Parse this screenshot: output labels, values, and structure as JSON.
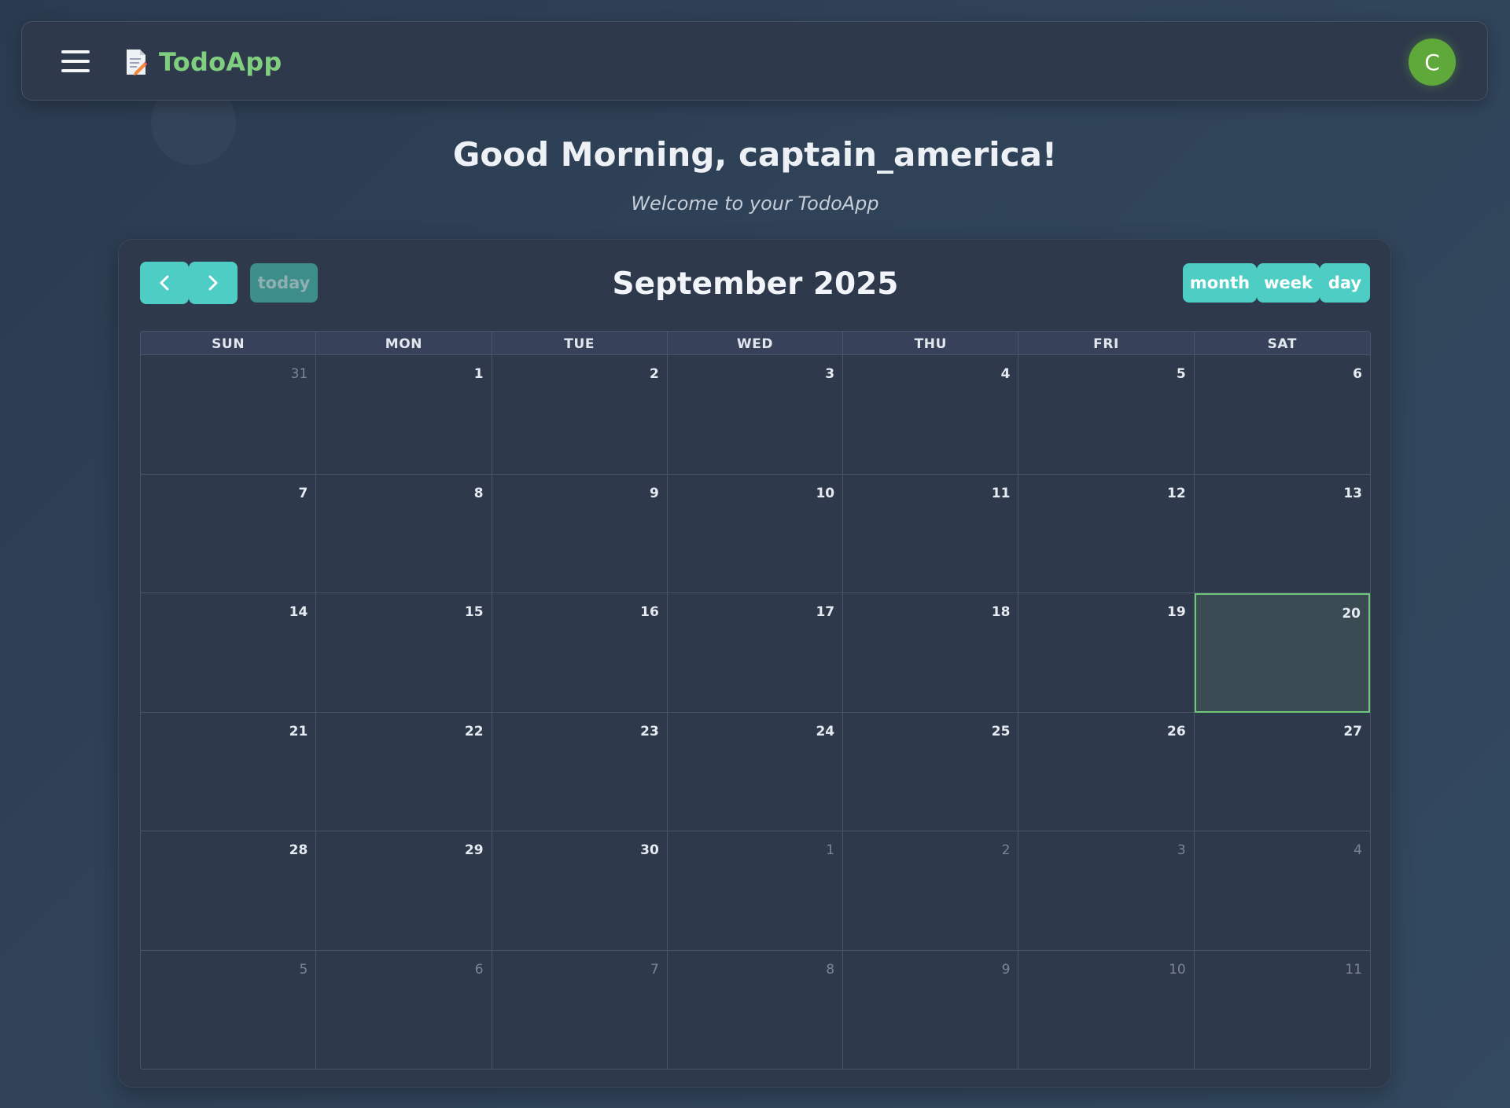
{
  "navbar": {
    "menu_icon": "hamburger-menu-icon",
    "brand_icon": "notepad-icon",
    "brand_name": "TodoApp",
    "avatar_initial": "C"
  },
  "greeting": {
    "title": "Good Morning, captain_america!",
    "subtitle": "Welcome to your TodoApp"
  },
  "calendar": {
    "title": "September 2025",
    "prev_icon": "chevron-left-icon",
    "next_icon": "chevron-right-icon",
    "today_label": "today",
    "view_buttons": {
      "month": "month",
      "week": "week",
      "day": "day"
    },
    "weekdays": [
      "SUN",
      "MON",
      "TUE",
      "WED",
      "THU",
      "FRI",
      "SAT"
    ],
    "weeks": [
      [
        {
          "d": "31",
          "other": true
        },
        {
          "d": "1"
        },
        {
          "d": "2"
        },
        {
          "d": "3"
        },
        {
          "d": "4"
        },
        {
          "d": "5"
        },
        {
          "d": "6"
        }
      ],
      [
        {
          "d": "7"
        },
        {
          "d": "8"
        },
        {
          "d": "9"
        },
        {
          "d": "10"
        },
        {
          "d": "11"
        },
        {
          "d": "12"
        },
        {
          "d": "13"
        }
      ],
      [
        {
          "d": "14"
        },
        {
          "d": "15"
        },
        {
          "d": "16"
        },
        {
          "d": "17"
        },
        {
          "d": "18"
        },
        {
          "d": "19"
        },
        {
          "d": "20",
          "today": true
        }
      ],
      [
        {
          "d": "21"
        },
        {
          "d": "22"
        },
        {
          "d": "23"
        },
        {
          "d": "24"
        },
        {
          "d": "25"
        },
        {
          "d": "26"
        },
        {
          "d": "27"
        }
      ],
      [
        {
          "d": "28"
        },
        {
          "d": "29"
        },
        {
          "d": "30"
        },
        {
          "d": "1",
          "other": true
        },
        {
          "d": "2",
          "other": true
        },
        {
          "d": "3",
          "other": true
        },
        {
          "d": "4",
          "other": true
        }
      ],
      [
        {
          "d": "5",
          "other": true
        },
        {
          "d": "6",
          "other": true
        },
        {
          "d": "7",
          "other": true
        },
        {
          "d": "8",
          "other": true
        },
        {
          "d": "9",
          "other": true
        },
        {
          "d": "10",
          "other": true
        },
        {
          "d": "11",
          "other": true
        }
      ]
    ]
  },
  "colors": {
    "accent": "#4ecdc4",
    "brand": "#7fcf7f",
    "avatar": "#5fa83a",
    "today_border": "#6fc77a",
    "card_bg": "#2e394c"
  }
}
